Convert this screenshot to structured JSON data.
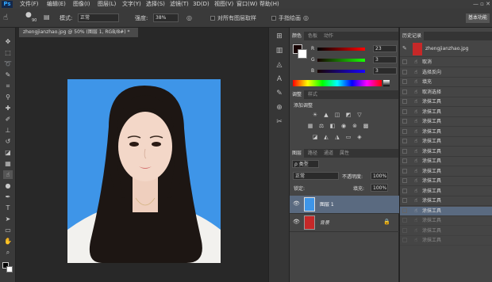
{
  "app": {
    "logo": "Ps"
  },
  "menu": [
    "文件(F)",
    "编辑(E)",
    "图像(I)",
    "图层(L)",
    "文字(Y)",
    "选择(S)",
    "滤镜(T)",
    "3D(D)",
    "视图(V)",
    "窗口(W)",
    "帮助(H)"
  ],
  "window_controls": "— ▫ ✕",
  "options": {
    "brush_size": "90",
    "mode_label": "模式:",
    "mode_value": "正常",
    "strength_label": "强度:",
    "strength_value": "38%",
    "sample_all_label": "对所有图层取样",
    "finger_label": "手指绘画",
    "workspace": "基本功能"
  },
  "document": {
    "tab": "zhengjianzhao.jpg @ 50% (图层 1, RGB/8#) *"
  },
  "color_panel": {
    "tabs": [
      "颜色",
      "色板",
      "动作"
    ],
    "sliders": [
      {
        "label": "R",
        "value": "23",
        "color": "#e03c3c"
      },
      {
        "label": "G",
        "value": "3",
        "color": "#3ccf3c"
      },
      {
        "label": "B",
        "value": "3",
        "color": "#3c5cff"
      }
    ]
  },
  "adjustments": {
    "tabs": [
      "调整",
      "样式"
    ],
    "title": "添加调整"
  },
  "layers": {
    "tabs": [
      "图层",
      "路径",
      "通道",
      "属性"
    ],
    "kind_label": "ρ 类型",
    "blend": "正常",
    "opacity_label": "不透明度:",
    "opacity": "100%",
    "lock_label": "锁定:",
    "fill_label": "填充:",
    "fill": "100%",
    "items": [
      {
        "name": "图层 1",
        "selected": true
      },
      {
        "name": "背景",
        "selected": false
      }
    ]
  },
  "history": {
    "tab": "历史记录",
    "snapshot": "zhengjianzhao.jpg",
    "items": [
      "取消",
      "选择反向",
      "填充",
      "取消选择",
      "涂抹工具",
      "涂抹工具",
      "涂抹工具",
      "涂抹工具",
      "涂抹工具",
      "涂抹工具",
      "涂抹工具",
      "涂抹工具",
      "涂抹工具",
      "涂抹工具",
      "涂抹工具",
      "涂抹工具",
      "涂抹工具",
      "涂抹工具",
      "涂抹工具"
    ]
  }
}
